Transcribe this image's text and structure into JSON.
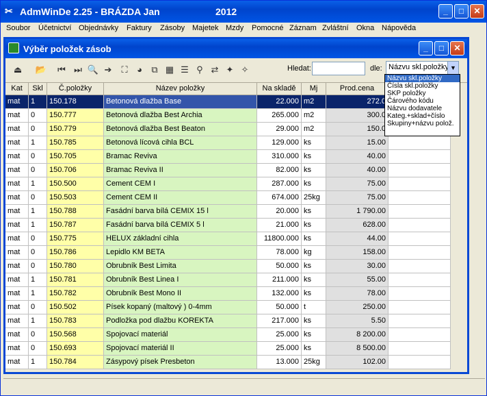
{
  "app": {
    "title": "AdmWinDe 2.25 - BRÁZDA Jan",
    "year": "2012"
  },
  "menu": [
    "Soubor",
    "Účetnictví",
    "Objednávky",
    "Faktury",
    "Zásoby",
    "Majetek",
    "Mzdy",
    "Pomocné",
    "Záznam",
    "Zvláštní",
    "Okna",
    "Nápověda"
  ],
  "window": {
    "title": "Výběr položek zásob"
  },
  "search": {
    "label": "Hledat:",
    "value": "",
    "by_label": "dle:",
    "selected": "Názvu skl.položky"
  },
  "dropdown_options": [
    "Názvu skl.položky",
    "Čísla skl.položky",
    "SKP položky",
    "Čárového kódu",
    "Názvu dodavatele",
    "Kateg.+sklad+číslo",
    "Skupiny+názvu polož."
  ],
  "columns": [
    "Kat",
    "Skl",
    "Č.položky",
    "Název položky",
    "Na skladě",
    "Mj",
    "Prod.cena"
  ],
  "rows": [
    [
      "mat",
      "1",
      "150.178",
      "Betonová dlažba Base",
      "22.000",
      "m2",
      "272.0"
    ],
    [
      "mat",
      "0",
      "150.777",
      "Betonová dlažba Best Archia",
      "265.000",
      "m2",
      "300.0"
    ],
    [
      "mat",
      "0",
      "150.779",
      "Betonová dlažba Best Beaton",
      "29.000",
      "m2",
      "150.0"
    ],
    [
      "mat",
      "1",
      "150.785",
      "Betonová lícová cihla BCL",
      "129.000",
      "ks",
      "15.00"
    ],
    [
      "mat",
      "0",
      "150.705",
      "Bramac Reviva",
      "310.000",
      "ks",
      "40.00"
    ],
    [
      "mat",
      "0",
      "150.706",
      "Bramac Reviva II",
      "82.000",
      "ks",
      "40.00"
    ],
    [
      "mat",
      "1",
      "150.500",
      "Cement CEM I",
      "287.000",
      "ks",
      "75.00"
    ],
    [
      "mat",
      "0",
      "150.503",
      "Cement CEM II",
      "674.000",
      "25kg",
      "75.00"
    ],
    [
      "mat",
      "1",
      "150.788",
      "Fasádní barva bílá CEMIX 15 l",
      "20.000",
      "ks",
      "1 790.00"
    ],
    [
      "mat",
      "1",
      "150.787",
      "Fasádní barva bílá CEMIX 5 l",
      "21.000",
      "ks",
      "628.00"
    ],
    [
      "mat",
      "0",
      "150.775",
      "HELUX základní cihla",
      "11800.000",
      "ks",
      "44.00"
    ],
    [
      "mat",
      "0",
      "150.786",
      "Lepidlo KM BETA",
      "78.000",
      "kg",
      "158.00"
    ],
    [
      "mat",
      "0",
      "150.780",
      "Obrubník Best Limita",
      "50.000",
      "ks",
      "30.00"
    ],
    [
      "mat",
      "1",
      "150.781",
      "Obrubník Best Linea I",
      "211.000",
      "ks",
      "55.00"
    ],
    [
      "mat",
      "1",
      "150.782",
      "Obrubník Best Mono II",
      "132.000",
      "ks",
      "78.00"
    ],
    [
      "mat",
      "0",
      "150.502",
      "Písek kopaný (maltový ) 0-4mm",
      "50.000",
      "t",
      "250.00"
    ],
    [
      "mat",
      "1",
      "150.783",
      "Podložka pod dlažbu KOREKTA",
      "217.000",
      "ks",
      "5.50"
    ],
    [
      "mat",
      "0",
      "150.568",
      "Spojovací materiál",
      "25.000",
      "ks",
      "8 200.00"
    ],
    [
      "mat",
      "0",
      "150.693",
      "Spojovací materiál II",
      "25.000",
      "ks",
      "8 500.00"
    ],
    [
      "mat",
      "1",
      "150.784",
      "Zásypový písek Presbeton",
      "13.000",
      "25kg",
      "102.00"
    ]
  ]
}
